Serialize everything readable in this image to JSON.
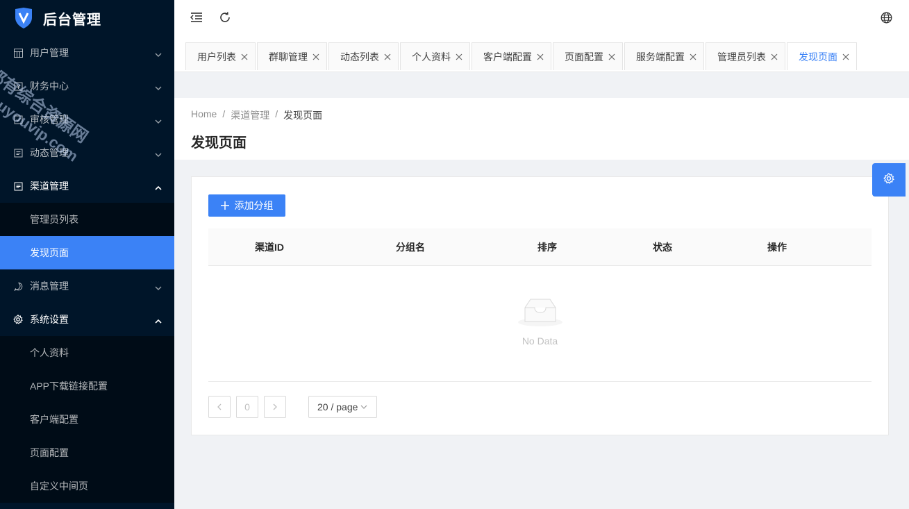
{
  "app": {
    "title": "后台管理"
  },
  "sidebar": {
    "items": [
      {
        "label": "用户管理",
        "icon": "table-icon",
        "state": "collapsed"
      },
      {
        "label": "财务中心",
        "icon": "wallet-icon",
        "state": "collapsed"
      },
      {
        "label": "审核管理",
        "icon": "checkbox-icon",
        "state": "collapsed"
      },
      {
        "label": "动态管理",
        "icon": "file-icon",
        "state": "collapsed"
      },
      {
        "label": "渠道管理",
        "icon": "file-icon",
        "state": "expanded",
        "children": [
          "管理员列表",
          "发现页面"
        ],
        "active_child": "发现页面"
      },
      {
        "label": "消息管理",
        "icon": "chat-icon",
        "state": "collapsed"
      },
      {
        "label": "系统设置",
        "icon": "gear-icon",
        "state": "expanded",
        "children": [
          "个人资料",
          "APP下载链接配置",
          "客户端配置",
          "页面配置",
          "自定义中间页"
        ]
      }
    ]
  },
  "header": {
    "menu_toggle_icon": "menu-fold-icon",
    "reload_icon": "reload-icon",
    "language_icon": "globe-icon"
  },
  "tabs": [
    {
      "label": "用户列表"
    },
    {
      "label": "群聊管理"
    },
    {
      "label": "动态列表"
    },
    {
      "label": "个人资料"
    },
    {
      "label": "客户端配置"
    },
    {
      "label": "页面配置"
    },
    {
      "label": "服务端配置"
    },
    {
      "label": "管理员列表"
    },
    {
      "label": "发现页面",
      "active": true
    }
  ],
  "tab_close_glyph": "X",
  "breadcrumb": [
    "Home",
    "渠道管理",
    "发现页面"
  ],
  "breadcrumb_sep": "/",
  "page": {
    "title": "发现页面"
  },
  "toolbar": {
    "add_label": "添加分组",
    "add_icon": "plus-icon"
  },
  "table": {
    "columns": [
      "渠道ID",
      "分组名",
      "排序",
      "状态",
      "操作"
    ],
    "rows": [],
    "empty_text": "No Data"
  },
  "pagination": {
    "prev_icon": "chevron-left-icon",
    "current": "0",
    "next_icon": "chevron-right-icon",
    "page_size": "20 / page"
  },
  "watermark": {
    "line1": "都有综合资源网",
    "line2": "douyouvip.com"
  },
  "colors": {
    "sidebar_bg": "#001529",
    "accent": "#3b82f6",
    "submenu_bg": "#000c17"
  }
}
